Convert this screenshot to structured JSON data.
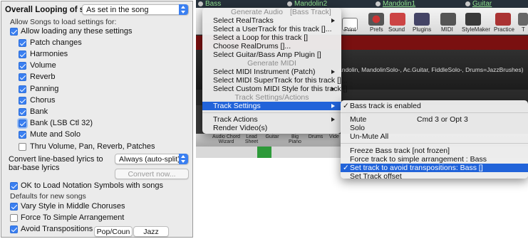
{
  "left": {
    "overall_looping_label": "Overall Looping of song",
    "overall_looping_value": "As set in the song",
    "allow_songs_group": "Allow Songs to load settings for:",
    "allow_loading_label": "Allow loading any these settings",
    "settings": [
      {
        "label": "Patch changes",
        "checked": true
      },
      {
        "label": "Harmonies",
        "checked": true
      },
      {
        "label": "Volume",
        "checked": true
      },
      {
        "label": "Reverb",
        "checked": true
      },
      {
        "label": "Panning",
        "checked": true
      },
      {
        "label": "Chorus",
        "checked": true
      },
      {
        "label": "Bank",
        "checked": true
      },
      {
        "label": "Bank (LSB Ctl 32)",
        "checked": true
      },
      {
        "label": "Mute and Solo",
        "checked": true
      },
      {
        "label": "Thru Volume, Pan, Reverb, Patches",
        "checked": false
      }
    ],
    "convert_label_1": "Convert line-based lyrics to",
    "convert_label_2": "bar-base lyrics",
    "convert_value": "Always (auto-split)",
    "convert_now_button": "Convert now...",
    "ok_notation_label": "OK to Load Notation Symbols with songs",
    "defaults_group": "Defaults for new songs",
    "vary_style_label": "Vary Style in Middle Choruses",
    "force_simple_label": "Force To Simple Arrangement",
    "avoid_transpositions_label": "Avoid Transpositions",
    "pop_button": "Pop/Coun",
    "jazz_button": "Jazz"
  },
  "right": {
    "tracks": [
      "Bass",
      "Mandolin2",
      "Mandolin1",
      "Guitar"
    ],
    "toolbar": [
      "Print",
      "Prefs",
      "Sound",
      "Plugins",
      "MIDI",
      "StyleMaker",
      "Practice",
      "T"
    ],
    "style_line": "andolin, MandolinSolo-, Ac.Guitar, FiddleSolo-, Drums=JazzBrushes)",
    "tabs": [
      "Audio Chord Wizard",
      "Lead Sheet",
      "Guitar",
      "Big Piano",
      "Drums",
      "Vide"
    ],
    "menu1": {
      "generate_audio_header": "Generate Audio",
      "bass_track_header": "[Bass Track]",
      "items_audio": [
        {
          "label": "Select RealTracks",
          "submenu": true
        },
        {
          "label": "Select a UserTrack for this track  []...",
          "submenu": false
        },
        {
          "label": "Select a Loop for this track  []",
          "submenu": false
        },
        {
          "label": "Choose RealDrums []...",
          "submenu": false
        },
        {
          "label": "Select Guitar/Bass Amp Plugin []",
          "submenu": false
        }
      ],
      "generate_midi_header": "Generate MIDI",
      "items_midi": [
        {
          "label": "Select MIDI Instrument (Patch)",
          "submenu": true
        },
        {
          "label": "Select MIDI SuperTrack for this track  []...",
          "submenu": false
        },
        {
          "label": "Select Custom MIDI Style for this track  []",
          "submenu": true
        }
      ],
      "track_settings_header": "Track Settings/Actions",
      "track_settings_item": "Track Settings",
      "track_actions_item": "Track Actions",
      "render_video_item": "Render Video(s)"
    },
    "menu2": {
      "bass_enabled": "Bass track is enabled",
      "mute": "Mute",
      "mute_shortcut": "Cmd 3 or  Opt 3",
      "solo": "Solo",
      "unmute_all": "Un-Mute All",
      "freeze": "Freeze Bass track     [not frozen]",
      "force_simple": "Force track to simple arrangement : Bass",
      "avoid_transpositions": "Set track to avoid transpositions: Bass []",
      "offset": "Set Track offset"
    }
  },
  "colors": {
    "accent": "#2163d9",
    "checkbox": "#3a7ff1",
    "track_green": "#8fe08f",
    "menu_bg": "#ececec"
  }
}
